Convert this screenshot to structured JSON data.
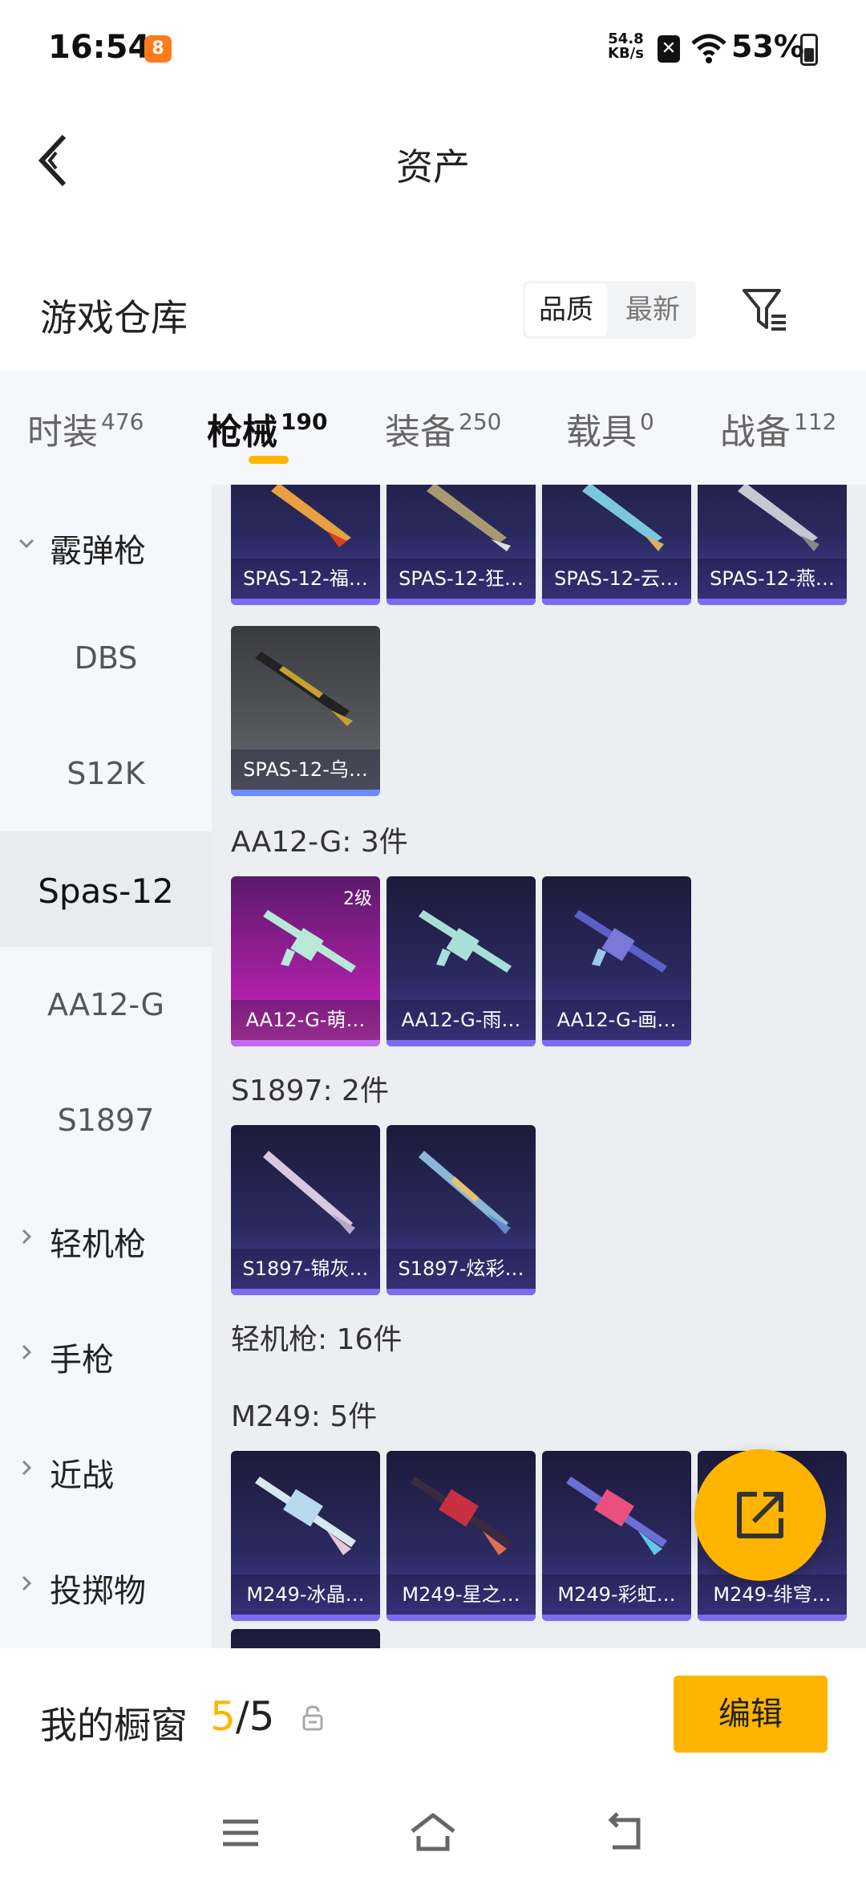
{
  "status_bar": {
    "time": "16:54",
    "speed_value": "54.8",
    "speed_unit": "KB/s",
    "battery": "53%"
  },
  "header": {
    "title": "资产"
  },
  "warehouse": {
    "title": "游戏仓库",
    "sort_options": [
      "品质",
      "最新"
    ],
    "sort_active": "品质"
  },
  "tabs": [
    {
      "label": "时装",
      "count": "476"
    },
    {
      "label": "枪械",
      "count": "190"
    },
    {
      "label": "装备",
      "count": "250"
    },
    {
      "label": "载具",
      "count": "0"
    },
    {
      "label": "战备",
      "count": "112"
    }
  ],
  "sidebar": {
    "items": [
      {
        "label": "霰弹枪",
        "type": "category",
        "expanded": true
      },
      {
        "label": "DBS",
        "type": "sub"
      },
      {
        "label": "S12K",
        "type": "sub"
      },
      {
        "label": "Spas-12",
        "type": "sub",
        "active": true
      },
      {
        "label": "AA12-G",
        "type": "sub"
      },
      {
        "label": "S1897",
        "type": "sub"
      },
      {
        "label": "轻机枪",
        "type": "category"
      },
      {
        "label": "手枪",
        "type": "category"
      },
      {
        "label": "近战",
        "type": "category"
      },
      {
        "label": "投掷物",
        "type": "category"
      }
    ]
  },
  "content": {
    "spas_cards": [
      "SPAS-12-福…",
      "SPAS-12-狂…",
      "SPAS-12-云…",
      "SPAS-12-燕…",
      "SPAS-12-乌…"
    ],
    "aa12_title": "AA12-G: 3件",
    "aa12_cards": [
      "AA12-G-萌…",
      "AA12-G-雨…",
      "AA12-G-画…"
    ],
    "aa12_level": "2级",
    "s1897_title": "S1897: 2件",
    "s1897_cards": [
      "S1897-锦灰…",
      "S1897-炫彩…"
    ],
    "lmg_title": "轻机枪: 16件",
    "m249_title": "M249: 5件",
    "m249_cards": [
      "M249-冰晶…",
      "M249-星之…",
      "M249-彩虹…",
      "M249-绯穹…"
    ]
  },
  "showcase": {
    "title": "我的橱窗",
    "current": "5",
    "separator": "/",
    "total": "5",
    "edit_label": "编辑"
  },
  "colors": {
    "accent": "#ffb400",
    "card_purple": "#2b2a60"
  }
}
